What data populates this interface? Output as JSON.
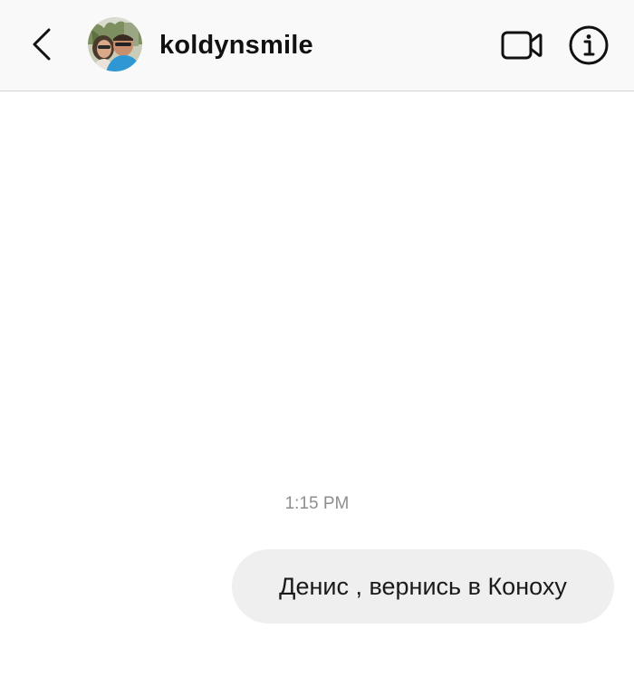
{
  "header": {
    "username": "koldynsmile",
    "icons": {
      "back": "chevron-left-icon",
      "avatar": "profile-photo",
      "video": "video-camera-icon",
      "info": "info-icon"
    }
  },
  "conversation": {
    "timestamp": "1:15 PM",
    "messages": [
      {
        "direction": "outgoing",
        "text": "Денис , вернись в Коноху"
      }
    ]
  },
  "colors": {
    "header_bg": "#f9f9f9",
    "bubble_bg": "#efefef",
    "timestamp": "#8e8e8e",
    "icon": "#111111"
  }
}
